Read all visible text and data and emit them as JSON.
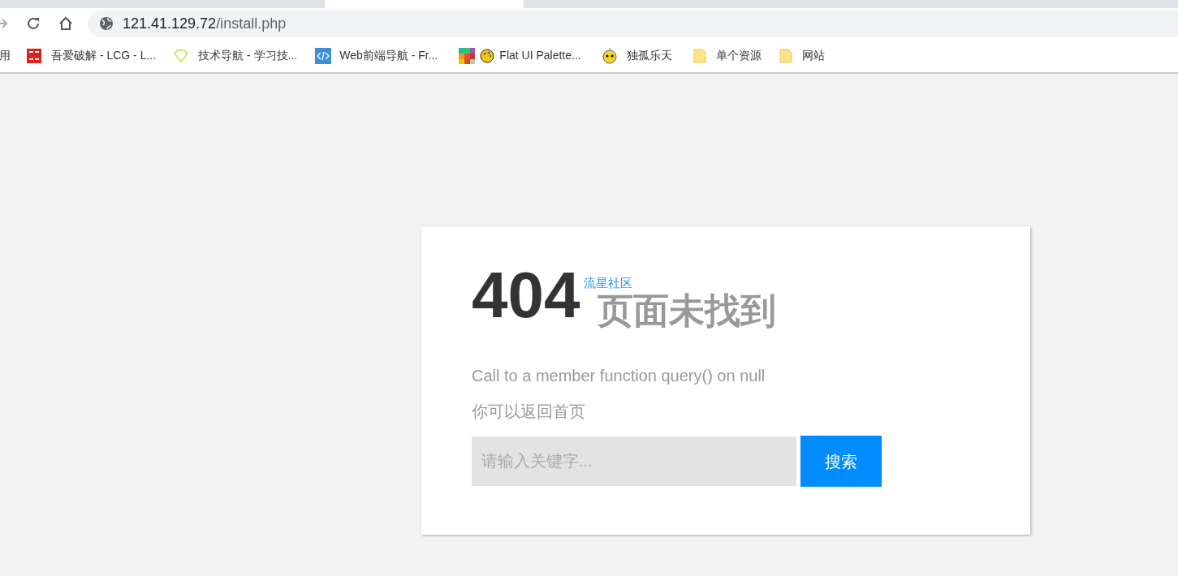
{
  "address_bar": {
    "host": "121.41.129.72",
    "path": "/install.php"
  },
  "bookmarks": [
    {
      "label": "用",
      "kind": "none"
    },
    {
      "label": "吾爱破解 - LCG - L...",
      "kind": "seal"
    },
    {
      "label": "技术导航 - 学习技...",
      "kind": "gem"
    },
    {
      "label": "Web前端导航 - Fr...",
      "kind": "code"
    },
    {
      "label": "Flat UI Palette...",
      "kind": "palette"
    },
    {
      "label": "独孤乐天",
      "kind": "face"
    },
    {
      "label": "单个资源",
      "kind": "folder"
    },
    {
      "label": "网站",
      "kind": "folder"
    }
  ],
  "error_page": {
    "code": "404",
    "overlay": "流星社区",
    "title": "页面未找到",
    "message": "Call to a member function query() on null",
    "hint": "你可以返回首页",
    "search": {
      "placeholder": "请输入关键字...",
      "button": "搜索"
    }
  }
}
